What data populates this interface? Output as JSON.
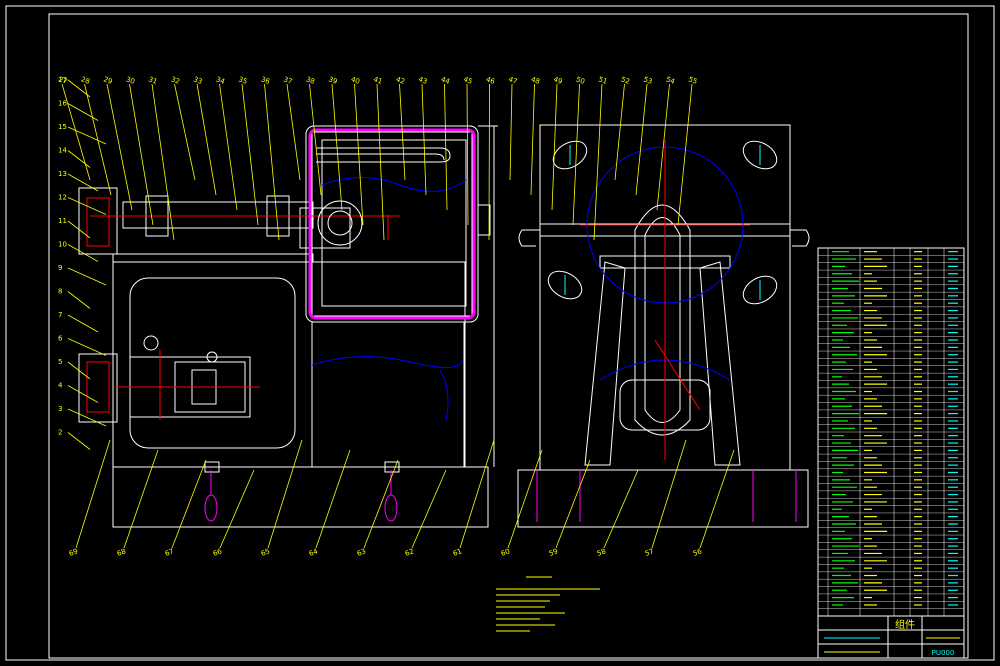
{
  "colors": {
    "background": "#000000",
    "frame": "#ffffff",
    "leader": "#ffff00",
    "centerline": "#ff0000",
    "hidden": "#0000ff",
    "dimension": "#00ffff",
    "magenta": "#ff00ff",
    "green": "#00ff00"
  },
  "drawing": {
    "title_block": {
      "heading": "组件",
      "code": "PU000"
    }
  },
  "balloons": {
    "left_column": [
      "17",
      "16",
      "15",
      "14",
      "13",
      "12",
      "11",
      "10",
      "9",
      "8",
      "7",
      "6",
      "5",
      "4",
      "3",
      "2"
    ],
    "top_row": [
      "27",
      "28",
      "29",
      "30",
      "31",
      "32",
      "33",
      "34",
      "35",
      "36",
      "37",
      "38",
      "39",
      "40",
      "41",
      "42",
      "43",
      "44",
      "45",
      "46",
      "47",
      "48",
      "49",
      "50",
      "51",
      "52",
      "53",
      "54",
      "55"
    ],
    "bottom_row": [
      "69",
      "68",
      "67",
      "66",
      "65",
      "64",
      "63",
      "62",
      "61",
      "60",
      "59",
      "58",
      "57",
      "56"
    ]
  },
  "icons": [
    "drill-hole-icon",
    "motor-icon",
    "pulley-icon"
  ]
}
